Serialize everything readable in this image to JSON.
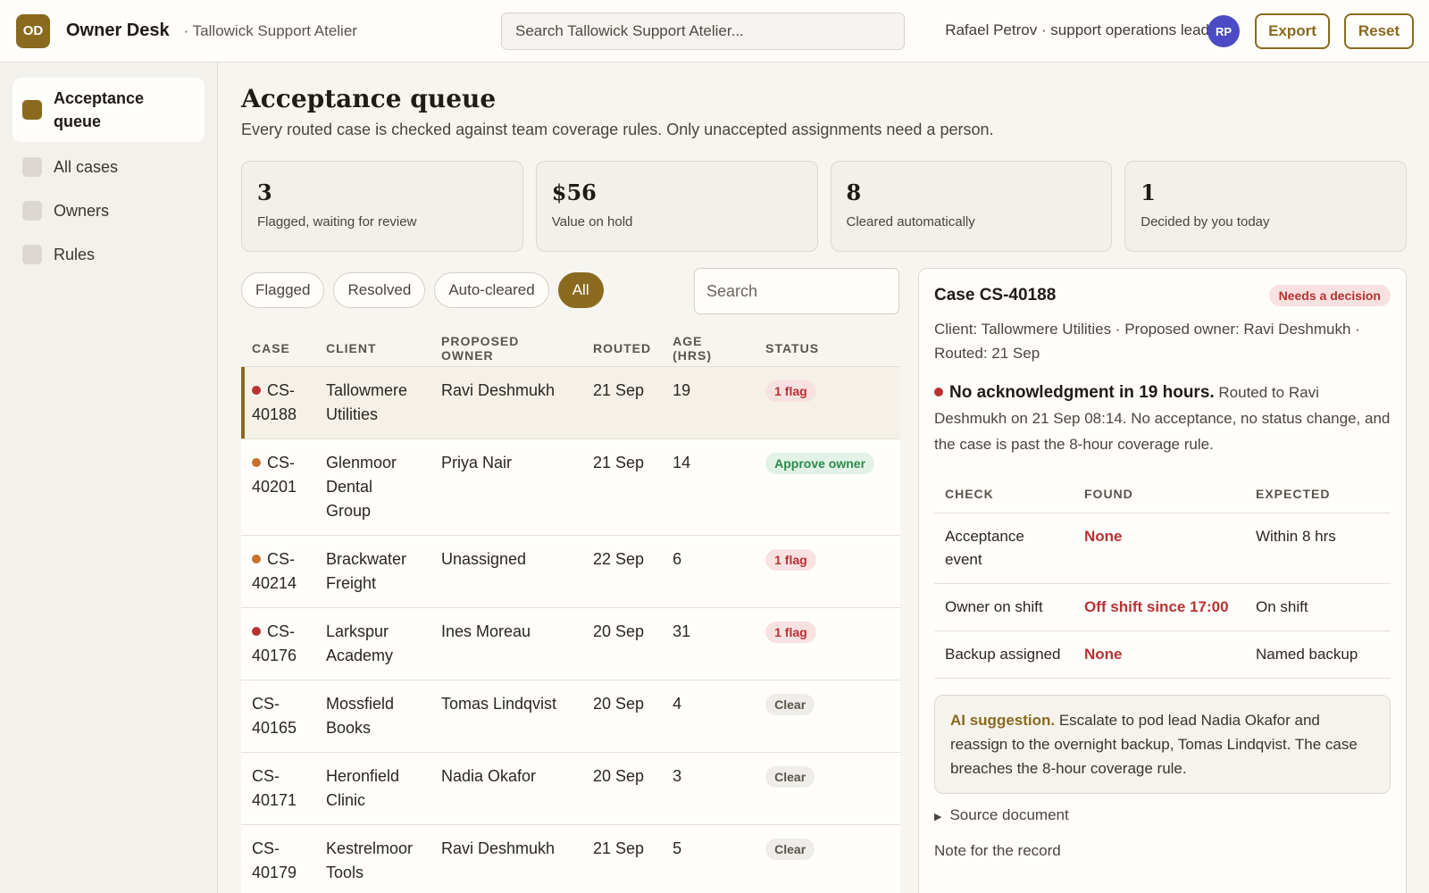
{
  "header": {
    "logo": "OD",
    "app_name": "Owner Desk",
    "workspace": "· Tallowick Support Atelier",
    "search_placeholder": "Search Tallowick Support Atelier...",
    "user": "Rafael Petrov · support operations lead",
    "avatar": "RP",
    "export_label": "Export",
    "reset_label": "Reset"
  },
  "sidebar": {
    "items": [
      {
        "label": "Acceptance queue"
      },
      {
        "label": "All cases"
      },
      {
        "label": "Owners"
      },
      {
        "label": "Rules"
      }
    ]
  },
  "page": {
    "title": "Acceptance queue",
    "subtitle": "Every routed case is checked against team coverage rules. Only unaccepted assignments need a person."
  },
  "stats": [
    {
      "value": "3",
      "label": "Flagged, waiting for review"
    },
    {
      "value": "$56",
      "label": "Value on hold"
    },
    {
      "value": "8",
      "label": "Cleared automatically"
    },
    {
      "value": "1",
      "label": "Decided by you today"
    }
  ],
  "filters": {
    "chips": [
      "Flagged",
      "Resolved",
      "Auto-cleared",
      "All"
    ],
    "search_placeholder": "Search"
  },
  "table": {
    "columns": [
      "CASE",
      "CLIENT",
      "PROPOSED OWNER",
      "ROUTED",
      "AGE (HRS)",
      "STATUS"
    ],
    "rows": [
      {
        "case": "CS-40188",
        "client": "Tallowmere Utilities",
        "owner": "Ravi Deshmukh",
        "routed": "21 Sep",
        "age": "19",
        "status": "1 flag"
      },
      {
        "case": "CS-40201",
        "client": "Glenmoor Dental Group",
        "owner": "Priya Nair",
        "routed": "21 Sep",
        "age": "14",
        "status": "Approve owner"
      },
      {
        "case": "CS-40214",
        "client": "Brackwater Freight",
        "owner": "Unassigned",
        "routed": "22 Sep",
        "age": "6",
        "status": "1 flag"
      },
      {
        "case": "CS-40176",
        "client": "Larkspur Academy",
        "owner": "Ines Moreau",
        "routed": "20 Sep",
        "age": "31",
        "status": "1 flag"
      },
      {
        "case": "CS-40165",
        "client": "Mossfield Books",
        "owner": "Tomas Lindqvist",
        "routed": "20 Sep",
        "age": "4",
        "status": "Clear"
      },
      {
        "case": "CS-40171",
        "client": "Heronfield Clinic",
        "owner": "Nadia Okafor",
        "routed": "20 Sep",
        "age": "3",
        "status": "Clear"
      },
      {
        "case": "CS-40179",
        "client": "Kestrelmoor Tools",
        "owner": "Ravi Deshmukh",
        "routed": "21 Sep",
        "age": "5",
        "status": "Clear"
      }
    ]
  },
  "detail": {
    "title": "Case CS-40188",
    "badge": "Needs a decision",
    "meta": "Client: Tallowmere Utilities · Proposed owner: Ravi Deshmukh · Routed: 21 Sep",
    "headline": "No acknowledgment in 19 hours.",
    "description": " Routed to Ravi Deshmukh on 21 Sep 08:14. No acceptance, no status change, and the case is past the 8-hour coverage rule.",
    "check_columns": [
      "CHECK",
      "FOUND",
      "EXPECTED"
    ],
    "checks": [
      {
        "check": "Acceptance event",
        "found": "None",
        "expected": "Within 8 hrs"
      },
      {
        "check": "Owner on shift",
        "found": "Off shift since 17:00",
        "expected": "On shift"
      },
      {
        "check": "Backup assigned",
        "found": "None",
        "expected": "Named backup"
      }
    ],
    "ai_label": "AI suggestion.",
    "ai_text": " Escalate to pod lead Nadia Okafor and reassign to the overnight backup, Tomas Lindqvist. The case breaches the 8-hour coverage rule.",
    "source_label": "Source document",
    "note_label": "Note for the record"
  },
  "colors": {
    "accent": "#8a6a1f",
    "danger": "#b83232",
    "success": "#2b8a4a",
    "warning": "#c9712a"
  }
}
